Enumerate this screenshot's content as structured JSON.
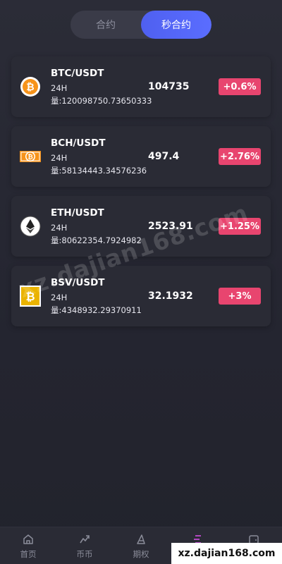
{
  "tabs": [
    {
      "label": "合约",
      "active": false
    },
    {
      "label": "秒合约",
      "active": true
    }
  ],
  "markets": [
    {
      "icon": "bitcoin-icon",
      "pair": "BTC/USDT",
      "period": "24H",
      "volume": "量:120098750.73650333",
      "price": "104735",
      "change": "+0.6%"
    },
    {
      "icon": "bitcoin-cash-icon",
      "pair": "BCH/USDT",
      "period": "24H",
      "volume": "量:58134443.34576236",
      "price": "497.4",
      "change": "+2.76%"
    },
    {
      "icon": "ethereum-icon",
      "pair": "ETH/USDT",
      "period": "24H",
      "volume": "量:80622354.7924982",
      "price": "2523.91",
      "change": "+1.25%"
    },
    {
      "icon": "bitcoin-sv-icon",
      "pair": "BSV/USDT",
      "period": "24H",
      "volume": "量:4348932.29370911",
      "price": "32.1932",
      "change": "+3%"
    }
  ],
  "watermark": "xz.dajian168.com",
  "corner_watermark": "xz.dajian168.com",
  "nav": [
    {
      "label": "首页",
      "icon": "home-icon",
      "active": false
    },
    {
      "label": "币币",
      "icon": "trend-icon",
      "active": false
    },
    {
      "label": "期权",
      "icon": "option-icon",
      "active": false
    },
    {
      "label": "",
      "icon": "contract-icon",
      "active": true
    },
    {
      "label": "",
      "icon": "wallet-icon",
      "active": false
    }
  ],
  "colors": {
    "accent": "#5a6dff",
    "change_badge": "#e8456f",
    "active_nav": "#c04bd0",
    "background": "#262731"
  }
}
